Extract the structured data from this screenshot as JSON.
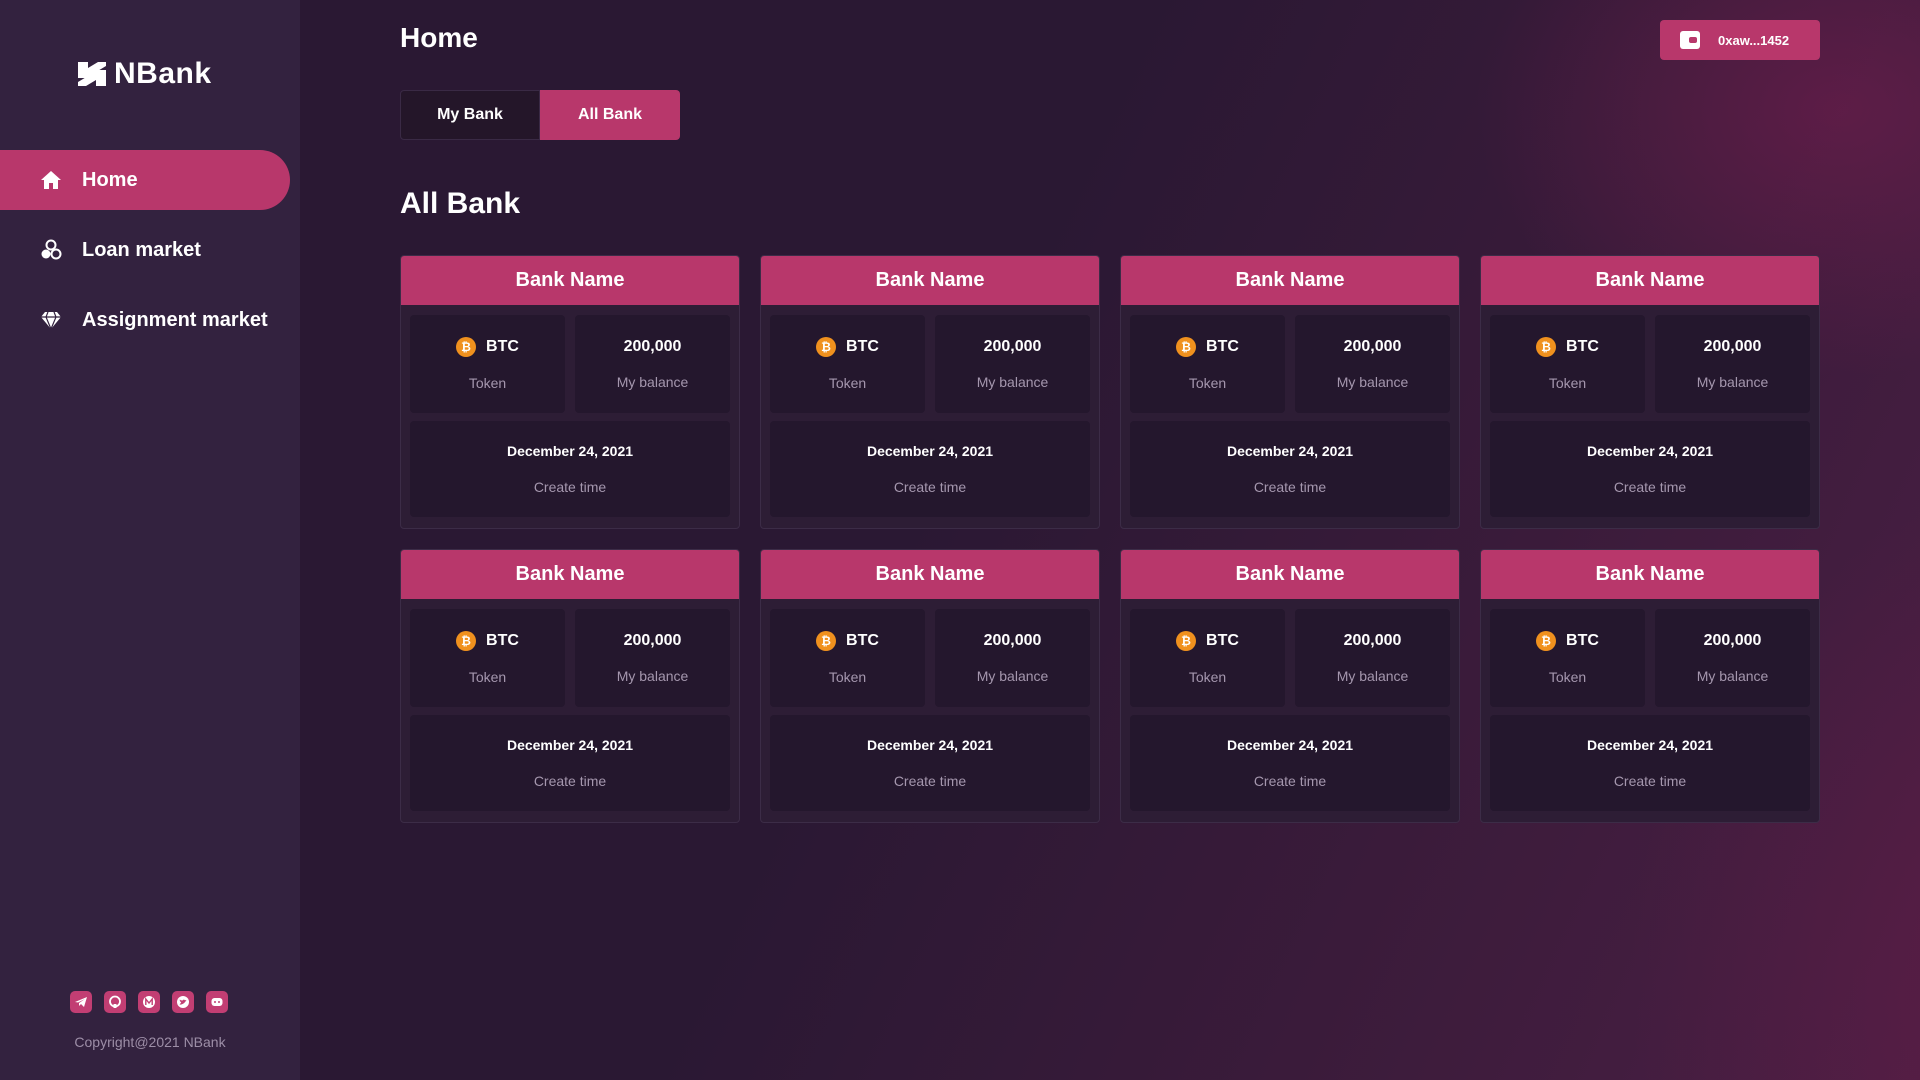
{
  "app": {
    "name": "NBank",
    "copyright": "Copyright@2021 NBank"
  },
  "sidebar": {
    "items": [
      {
        "label": "Home",
        "icon": "home-icon",
        "active": true
      },
      {
        "label": "Loan market",
        "icon": "coins-icon",
        "active": false
      },
      {
        "label": "Assignment market",
        "icon": "diamond-icon",
        "active": false
      }
    ],
    "socials": [
      "telegram-icon",
      "github-icon",
      "medium-icon",
      "twitter-icon",
      "discord-icon"
    ]
  },
  "header": {
    "title": "Home",
    "wallet_address": "0xaw...1452"
  },
  "tabs": [
    {
      "label": "My Bank",
      "active": false
    },
    {
      "label": "All Bank",
      "active": true
    }
  ],
  "section_title": "All Bank",
  "cards": [
    {
      "name": "Bank Name",
      "token": "BTC",
      "token_label": "Token",
      "balance": "200,000",
      "balance_label": "My balance",
      "date": "December 24, 2021",
      "date_label": "Create time"
    },
    {
      "name": "Bank Name",
      "token": "BTC",
      "token_label": "Token",
      "balance": "200,000",
      "balance_label": "My balance",
      "date": "December 24, 2021",
      "date_label": "Create time"
    },
    {
      "name": "Bank Name",
      "token": "BTC",
      "token_label": "Token",
      "balance": "200,000",
      "balance_label": "My balance",
      "date": "December 24, 2021",
      "date_label": "Create time"
    },
    {
      "name": "Bank Name",
      "token": "BTC",
      "token_label": "Token",
      "balance": "200,000",
      "balance_label": "My balance",
      "date": "December 24, 2021",
      "date_label": "Create time"
    },
    {
      "name": "Bank Name",
      "token": "BTC",
      "token_label": "Token",
      "balance": "200,000",
      "balance_label": "My balance",
      "date": "December 24, 2021",
      "date_label": "Create time"
    },
    {
      "name": "Bank Name",
      "token": "BTC",
      "token_label": "Token",
      "balance": "200,000",
      "balance_label": "My balance",
      "date": "December 24, 2021",
      "date_label": "Create time"
    },
    {
      "name": "Bank Name",
      "token": "BTC",
      "token_label": "Token",
      "balance": "200,000",
      "balance_label": "My balance",
      "date": "December 24, 2021",
      "date_label": "Create time"
    },
    {
      "name": "Bank Name",
      "token": "BTC",
      "token_label": "Token",
      "balance": "200,000",
      "balance_label": "My balance",
      "date": "December 24, 2021",
      "date_label": "Create time"
    }
  ],
  "colors": {
    "accent": "#b8376b",
    "sidebar_bg": "#33223f",
    "card_bg": "#2d1d35",
    "cell_bg": "#24172d",
    "btc": "#f0911e"
  }
}
